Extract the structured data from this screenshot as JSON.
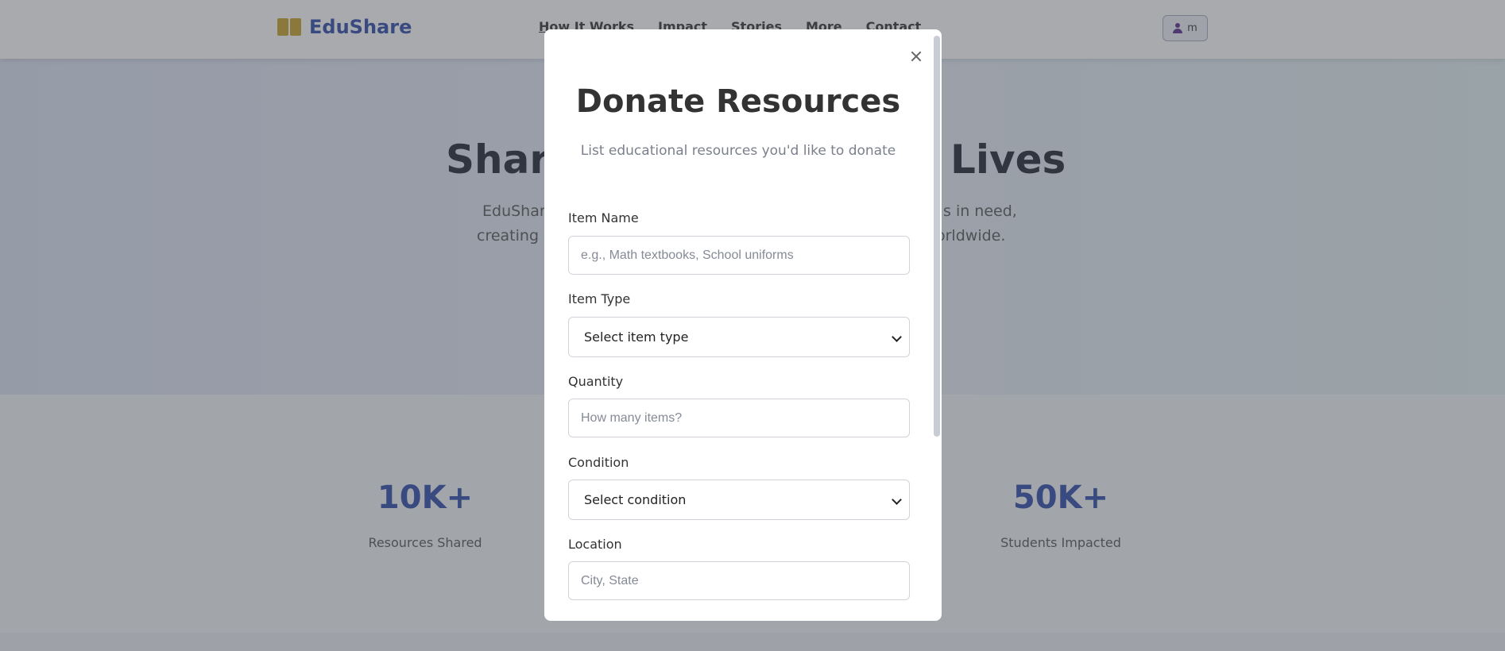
{
  "navbar": {
    "brand": "EduShare",
    "links": [
      "How It Works",
      "Impact",
      "Stories",
      "More",
      "Contact"
    ],
    "user_initial": "m"
  },
  "hero": {
    "title_left": "Share",
    "title_right": "Lives",
    "text_left_line1": "EduShare",
    "text_left_line2": "creating a",
    "text_right_line1": "s in need,",
    "text_right_line2": "orldwide."
  },
  "stats": [
    {
      "value": "10K+",
      "label": "Resources Shared"
    },
    {
      "value": "50K+",
      "label": "Students Impacted"
    }
  ],
  "modal": {
    "title": "Donate Resources",
    "subtitle": "List educational resources you'd like to donate",
    "fields": {
      "item_name": {
        "label": "Item Name",
        "placeholder": "e.g., Math textbooks, School uniforms"
      },
      "item_type": {
        "label": "Item Type",
        "selected": "Select item type"
      },
      "quantity": {
        "label": "Quantity",
        "placeholder": "How many items?"
      },
      "condition": {
        "label": "Condition",
        "selected": "Select condition"
      },
      "location": {
        "label": "Location",
        "placeholder": "City, State"
      }
    }
  }
}
